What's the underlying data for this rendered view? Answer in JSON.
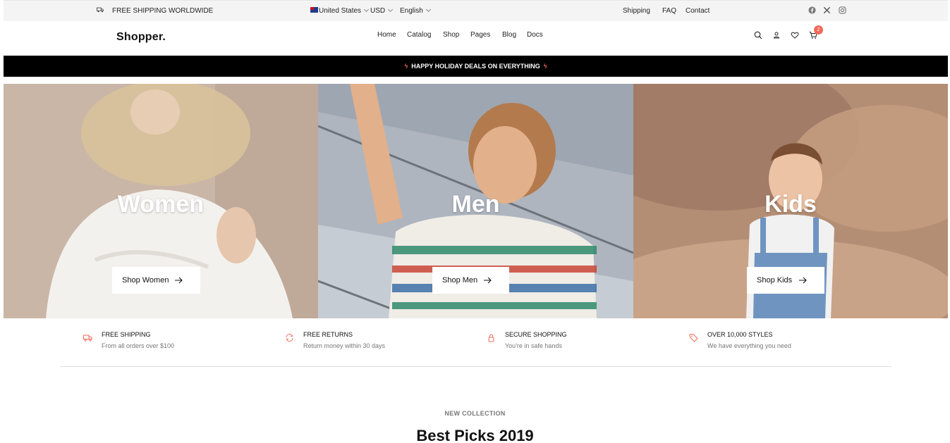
{
  "topbar": {
    "shipping_promo": "FREE SHIPPING WORLDWIDE",
    "country": "United States",
    "currency": "USD",
    "language": "English",
    "links": [
      "Shipping",
      "FAQ",
      "Contact"
    ],
    "social_icons": [
      "facebook-icon",
      "x-icon",
      "instagram-icon"
    ]
  },
  "navbar": {
    "logo": "Shopper.",
    "menu": [
      "Home",
      "Catalog",
      "Shop",
      "Pages",
      "Blog",
      "Docs"
    ],
    "icons": [
      "search-icon",
      "user-icon",
      "heart-icon",
      "cart-icon"
    ],
    "cart_count": "2"
  },
  "promo": {
    "text": "HAPPY HOLIDAY DEALS ON EVERYTHING",
    "bolt": "ϟ"
  },
  "hero": [
    {
      "title": "Women",
      "button": "Shop Women"
    },
    {
      "title": "Men",
      "button": "Shop Men"
    },
    {
      "title": "Kids",
      "button": "Shop Kids"
    }
  ],
  "features": [
    {
      "icon": "truck-icon",
      "title": "FREE SHIPPING",
      "subtitle": "From all orders over $100"
    },
    {
      "icon": "refresh-icon",
      "title": "FREE RETURNS",
      "subtitle": "Return money within 30 days"
    },
    {
      "icon": "lock-icon",
      "title": "SECURE SHOPPING",
      "subtitle": "You're in safe hands"
    },
    {
      "icon": "tag-icon",
      "title": "OVER 10,000 STYLES",
      "subtitle": "We have everything you need"
    }
  ],
  "section": {
    "eyebrow": "NEW COLLECTION",
    "title": "Best Picks 2019"
  },
  "colors": {
    "accent": "#f26a5b",
    "topbar_bg": "#f5f4f5",
    "promo_bg": "#000000"
  }
}
